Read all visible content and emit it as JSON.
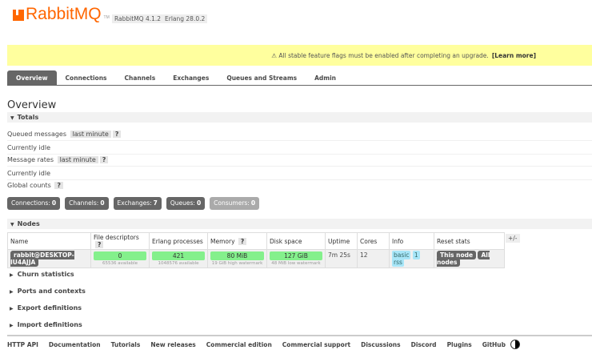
{
  "header": {
    "logo": "RabbitMQ",
    "tm": "TM",
    "version": "RabbitMQ 4.1.2",
    "erlang": "Erlang 28.0.2"
  },
  "banner": {
    "text": "⚠ All stable feature flags must be enabled after completing an upgrade.",
    "link": "[Learn more]"
  },
  "tabs": [
    "Overview",
    "Connections",
    "Channels",
    "Exchanges",
    "Queues and Streams",
    "Admin"
  ],
  "page_title": "Overview",
  "totals": {
    "title": "Totals",
    "queued_label": "Queued messages",
    "queued_range": "last minute",
    "help": "?",
    "idle1": "Currently idle",
    "rates_label": "Message rates",
    "rates_range": "last minute",
    "idle2": "Currently idle",
    "global_label": "Global counts"
  },
  "counts": [
    {
      "label": "Connections:",
      "value": "0"
    },
    {
      "label": "Channels:",
      "value": "0"
    },
    {
      "label": "Exchanges:",
      "value": "7"
    },
    {
      "label": "Queues:",
      "value": "0"
    },
    {
      "label": "Consumers:",
      "value": "0"
    }
  ],
  "nodes": {
    "title": "Nodes",
    "headers": [
      "Name",
      "File descriptors",
      "Erlang processes",
      "Memory",
      "Disk space",
      "Uptime",
      "Cores",
      "Info",
      "Reset stats"
    ],
    "plusminus": "+/-",
    "row": {
      "name": "rabbit@DESKTOP-IU4AJJA",
      "fd": "0",
      "fd_sub": "65536 available",
      "proc": "421",
      "proc_sub": "1048576 available",
      "mem": "80 MiB",
      "mem_sub": "19 GiB high watermark",
      "disk": "127 GiB",
      "disk_sub": "48 MiB low watermark",
      "uptime": "7m 25s",
      "cores": "12",
      "info": [
        "basic",
        "1",
        "rss"
      ],
      "reset": [
        "This node",
        "All nodes"
      ]
    }
  },
  "sections": [
    "Churn statistics",
    "Ports and contexts",
    "Export definitions",
    "Import definitions"
  ],
  "footer": [
    "HTTP API",
    "Documentation",
    "Tutorials",
    "New releases",
    "Commercial edition",
    "Commercial support",
    "Discussions",
    "Discord",
    "Plugins",
    "GitHub"
  ]
}
